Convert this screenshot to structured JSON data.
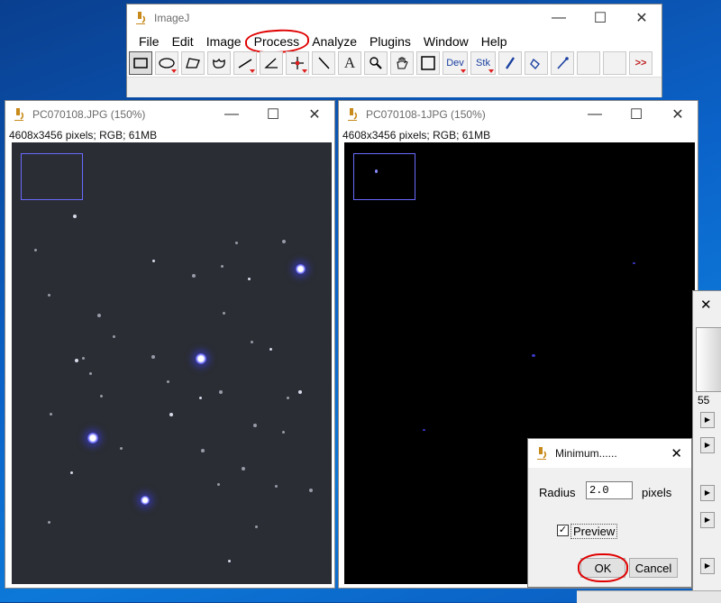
{
  "imagej": {
    "title": "ImageJ",
    "menu": [
      "File",
      "Edit",
      "Image",
      "Process",
      "Analyze",
      "Plugins",
      "Window",
      "Help"
    ],
    "tools": {
      "dev": "Dev",
      "stk": "Stk",
      "more": ">>",
      "text": "A"
    }
  },
  "window_left": {
    "title": "PC070108.JPG (150%)",
    "info": "4608x3456 pixels; RGB; 61MB"
  },
  "window_right": {
    "title": "PC070108-1JPG (150%)",
    "info": "4608x3456 pixels; RGB; 61MB"
  },
  "dialog": {
    "title": "Minimum......",
    "radius_label": "Radius",
    "radius_value": "2.0",
    "units": "pixels",
    "preview_label": "Preview",
    "preview_checked": true,
    "ok": "OK",
    "cancel": "Cancel"
  },
  "background_partial": {
    "text": "55"
  },
  "colors": {
    "annotation_red": "#e00000",
    "roi_blue": "#6a6aff",
    "desktop_blue": "#0b62c8"
  }
}
